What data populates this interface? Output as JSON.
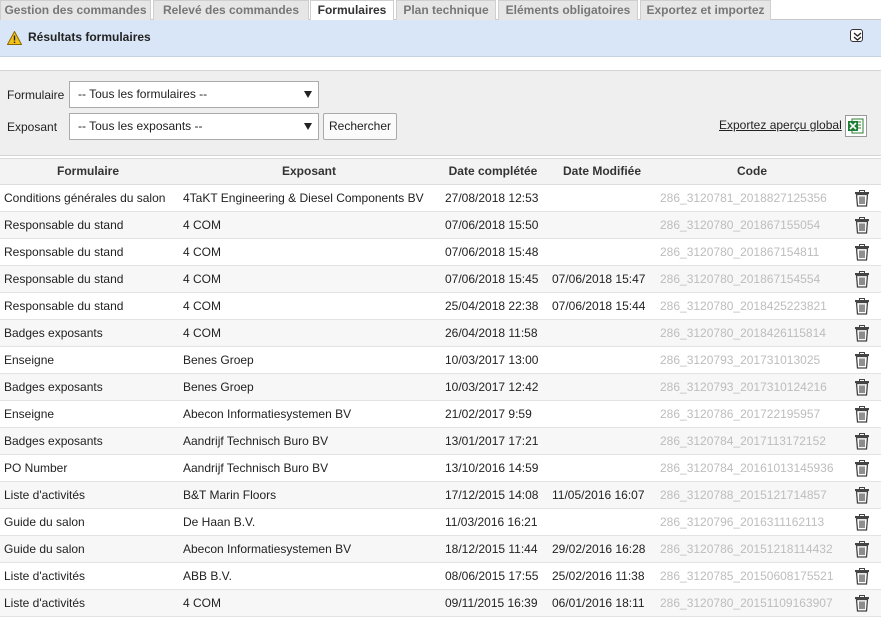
{
  "tabs": [
    {
      "label": "Gestion des commandes"
    },
    {
      "label": "Relevé des commandes"
    },
    {
      "label": "Formulaires"
    },
    {
      "label": "Plan technique"
    },
    {
      "label": "Eléments obligatoires"
    },
    {
      "label": "Exportez et importez"
    }
  ],
  "active_tab": "Formulaires",
  "results": {
    "title": "Résultats formulaires",
    "icon": "warning-icon",
    "collapse_icon": "chevron-double-down-icon"
  },
  "filters": {
    "formulaire_label": "Formulaire",
    "formulaire_value": "-- Tous les formulaires --",
    "exposant_label": "Exposant",
    "exposant_value": "-- Tous les exposants --",
    "search_label": "Rechercher",
    "export_label": "Exportez aperçu global",
    "export_icon": "excel-icon"
  },
  "table": {
    "headers": {
      "formulaire": "Formulaire",
      "exposant": "Exposant",
      "date_completed": "Date complétée",
      "date_modified": "Date Modifiée",
      "code": "Code"
    },
    "rows": [
      {
        "formulaire": "Conditions générales du salon",
        "exposant": "4TaKT Engineering & Diesel Components BV",
        "date_completed": "27/08/2018 12:53",
        "date_modified": "",
        "code": "286_3120781_2018827125356"
      },
      {
        "formulaire": "Responsable du stand",
        "exposant": "4 COM",
        "date_completed": "07/06/2018 15:50",
        "date_modified": "",
        "code": "286_3120780_201867155054"
      },
      {
        "formulaire": "Responsable du stand",
        "exposant": "4 COM",
        "date_completed": "07/06/2018 15:48",
        "date_modified": "",
        "code": "286_3120780_201867154811"
      },
      {
        "formulaire": "Responsable du stand",
        "exposant": "4 COM",
        "date_completed": "07/06/2018 15:45",
        "date_modified": "07/06/2018 15:47",
        "code": "286_3120780_201867154554"
      },
      {
        "formulaire": "Responsable du stand",
        "exposant": "4 COM",
        "date_completed": "25/04/2018 22:38",
        "date_modified": "07/06/2018 15:44",
        "code": "286_3120780_2018425223821"
      },
      {
        "formulaire": "Badges exposants",
        "exposant": "4 COM",
        "date_completed": "26/04/2018 11:58",
        "date_modified": "",
        "code": "286_3120780_2018426115814"
      },
      {
        "formulaire": "Enseigne",
        "exposant": "Benes Groep",
        "date_completed": "10/03/2017 13:00",
        "date_modified": "",
        "code": "286_3120793_201731013025"
      },
      {
        "formulaire": "Badges exposants",
        "exposant": "Benes Groep",
        "date_completed": "10/03/2017 12:42",
        "date_modified": "",
        "code": "286_3120793_2017310124216"
      },
      {
        "formulaire": "Enseigne",
        "exposant": "Abecon Informatiesystemen BV",
        "date_completed": "21/02/2017 9:59",
        "date_modified": "",
        "code": "286_3120786_201722195957"
      },
      {
        "formulaire": "Badges exposants",
        "exposant": "Aandrijf Technisch Buro BV",
        "date_completed": "13/01/2017 17:21",
        "date_modified": "",
        "code": "286_3120784_2017113172152"
      },
      {
        "formulaire": "PO Number",
        "exposant": "Aandrijf Technisch Buro BV",
        "date_completed": "13/10/2016 14:59",
        "date_modified": "",
        "code": "286_3120784_20161013145936"
      },
      {
        "formulaire": "Liste d'activités",
        "exposant": "B&T Marin Floors",
        "date_completed": "17/12/2015 14:08",
        "date_modified": "11/05/2016 16:07",
        "code": "286_3120788_2015121714857"
      },
      {
        "formulaire": "Guide du salon",
        "exposant": "De Haan B.V.",
        "date_completed": "11/03/2016 16:21",
        "date_modified": "",
        "code": "286_3120796_2016311162113"
      },
      {
        "formulaire": "Guide du salon",
        "exposant": "Abecon Informatiesystemen BV",
        "date_completed": "18/12/2015 11:44",
        "date_modified": "29/02/2016 16:28",
        "code": "286_3120786_20151218114432"
      },
      {
        "formulaire": "Liste d'activités",
        "exposant": "ABB B.V.",
        "date_completed": "08/06/2015 17:55",
        "date_modified": "25/02/2016 11:38",
        "code": "286_3120785_20150608175521"
      },
      {
        "formulaire": "Liste d'activités",
        "exposant": "4 COM",
        "date_completed": "09/11/2015 16:39",
        "date_modified": "06/01/2016 18:11",
        "code": "286_3120780_20151109163907"
      }
    ]
  }
}
